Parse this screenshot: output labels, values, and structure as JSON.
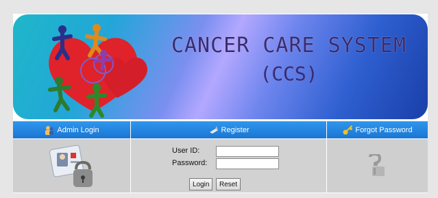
{
  "banner": {
    "title": "CANCER CARE SYSTEM",
    "subtitle": "(CCS)"
  },
  "tabs": [
    {
      "label": "Admin Login",
      "icon": "admin-icon"
    },
    {
      "label": "Register",
      "icon": "register-icon"
    },
    {
      "label": "Forgot Password",
      "icon": "key-icon"
    }
  ],
  "login": {
    "user_id_label": "User ID:",
    "password_label": "Password:",
    "user_id_value": "",
    "password_value": "",
    "login_button": "Login",
    "reset_button": "Reset"
  },
  "colors": {
    "tab_blue": "#1f86e0",
    "panel_gray": "#cfcfcf"
  }
}
